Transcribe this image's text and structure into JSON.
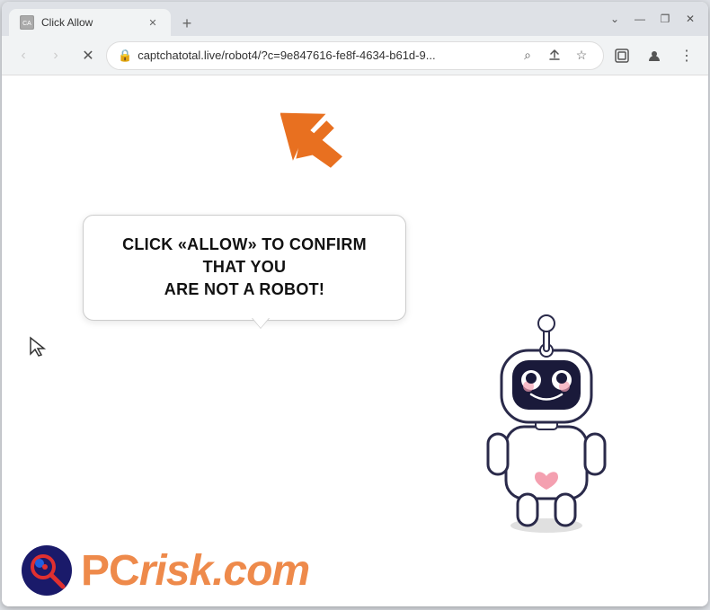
{
  "browser": {
    "tab": {
      "title": "Click Allow",
      "favicon_label": "CA"
    },
    "new_tab_label": "+",
    "window_controls": {
      "minimize": "—",
      "maximize": "❐",
      "close": "✕"
    },
    "toolbar": {
      "back_label": "‹",
      "forward_label": "›",
      "reload_label": "✕",
      "url": "captchatotal.live/robot4/?c=9e847616-fe8f-4634-b61d-9...",
      "lock_icon": "🔒",
      "search_icon": "⌕",
      "share_icon": "⎋",
      "star_icon": "☆",
      "tab_icon": "⊡",
      "profile_icon": "⊙",
      "menu_icon": "⋮"
    }
  },
  "page": {
    "bubble_text_line1": "CLICK «ALLOW» TO CONFIRM THAT YOU",
    "bubble_text_line2": "ARE NOT A ROBOT!",
    "pcrisk_prefix": "PC",
    "pcrisk_suffix": "risk.com"
  }
}
